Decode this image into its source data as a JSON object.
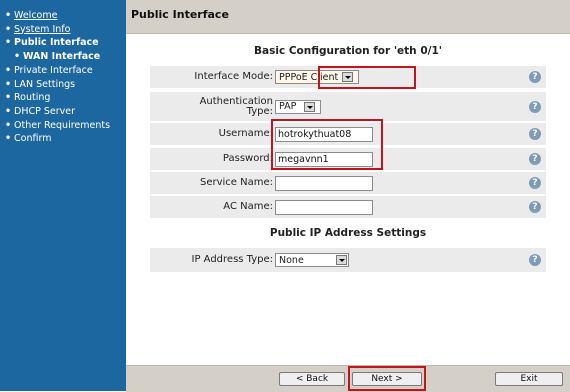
{
  "sidebar": {
    "items": [
      {
        "label": "Welcome"
      },
      {
        "label": "System Info"
      },
      {
        "label": "Public Interface"
      },
      {
        "label": "WAN Interface"
      },
      {
        "label": "Private Interface"
      },
      {
        "label": "LAN Settings"
      },
      {
        "label": "Routing"
      },
      {
        "label": "DHCP Server"
      },
      {
        "label": "Other Requirements"
      },
      {
        "label": "Confirm"
      }
    ]
  },
  "header": {
    "title": "Public Interface"
  },
  "basic": {
    "title": "Basic Configuration for 'eth 0/1'",
    "interface_mode": {
      "label": "Interface Mode:",
      "value": "PPPoE Client"
    },
    "auth_type": {
      "label": "Authentication Type:",
      "value": "PAP"
    },
    "username": {
      "label": "Username:",
      "value": "hotrokythuat08"
    },
    "password": {
      "label": "Password:",
      "value": "megavnn1"
    },
    "service_name": {
      "label": "Service Name:",
      "value": ""
    },
    "ac_name": {
      "label": "AC Name:",
      "value": ""
    }
  },
  "ip": {
    "title": "Public IP Address Settings",
    "ip_type": {
      "label": "IP Address Type:",
      "value": "None"
    }
  },
  "help_glyph": "?",
  "footer": {
    "back": "< Back",
    "next": "Next >",
    "exit": "Exit"
  },
  "colors": {
    "sidebar_bg": "#1c67a0",
    "highlight": "#c0141e",
    "panel_bg": "#d4d0c8"
  }
}
